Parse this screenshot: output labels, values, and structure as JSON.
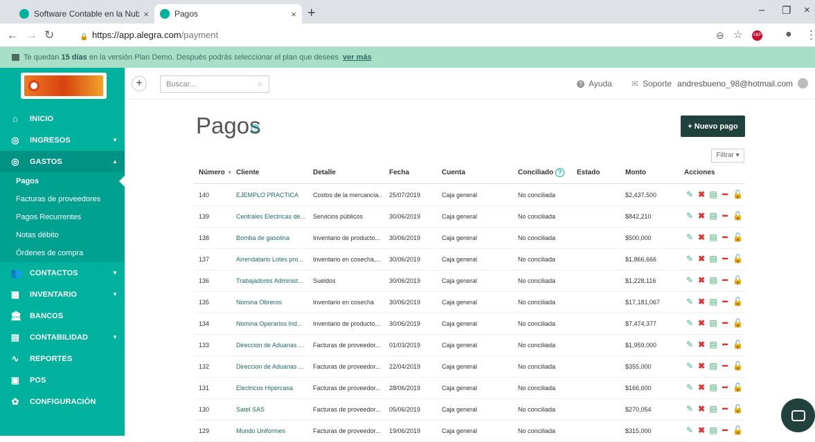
{
  "browser": {
    "tabs": [
      {
        "title": "Software Contable en la Nube pa",
        "close": "×"
      },
      {
        "title": "Pagos",
        "close": "×"
      }
    ],
    "new_tab": "+",
    "url_host": "https://app.alegra.com",
    "url_path": "/payment",
    "window_controls": {
      "minimize": "–",
      "maximize": "❐",
      "close": "×"
    }
  },
  "banner": {
    "text_before": "Te quedan",
    "days": "15 días",
    "text_after": "en la versión Plan Demo. Después podrás seleccionar el plan que desees",
    "link": "ver más"
  },
  "sidebar": {
    "items": [
      {
        "label": "INICIO",
        "icon": "home-icon",
        "glyph": "⌂"
      },
      {
        "label": "INGRESOS",
        "icon": "income-icon",
        "glyph": "◎",
        "caret": "▼"
      },
      {
        "label": "GASTOS",
        "icon": "expenses-icon",
        "glyph": "◎",
        "caret": "▲"
      },
      {
        "label": "CONTACTOS",
        "icon": "contacts-icon",
        "glyph": "👥",
        "caret": "▼"
      },
      {
        "label": "INVENTARIO",
        "icon": "inventory-icon",
        "glyph": "▦",
        "caret": "▼"
      },
      {
        "label": "BANCOS",
        "icon": "bank-icon",
        "glyph": "🏛"
      },
      {
        "label": "CONTABILIDAD",
        "icon": "accounting-icon",
        "glyph": "▤",
        "caret": "▼"
      },
      {
        "label": "REPORTES",
        "icon": "reports-icon",
        "glyph": "∿"
      },
      {
        "label": "POS",
        "icon": "pos-icon",
        "glyph": "▣"
      },
      {
        "label": "CONFIGURACIÓN",
        "icon": "settings-icon",
        "glyph": "✿"
      }
    ],
    "sub_items": [
      "Pagos",
      "Facturas de proveedores",
      "Pagos Recurrentes",
      "Notas débito",
      "Órdenes de compra"
    ]
  },
  "topbar": {
    "plus": "+",
    "search_placeholder": "Buscar...",
    "help": "Ayuda",
    "support": "Soporte",
    "user": "andresbueno_98@hotmail.com"
  },
  "page": {
    "title": "Pagos",
    "new_button": "+ Nuevo pago",
    "filter": "Filtrar ▾"
  },
  "table": {
    "headers": {
      "numero": "Número",
      "cliente": "Cliente",
      "detalle": "Detalle",
      "fecha": "Fecha",
      "cuenta": "Cuenta",
      "conciliado": "Conciliado",
      "estado": "Estado",
      "monto": "Monto",
      "acciones": "Acciones"
    },
    "rows": [
      {
        "numero": "140",
        "cliente": "EJEMPLO PRACTICA",
        "detalle": "Costos de la mercancía...",
        "fecha": "25/07/2019",
        "cuenta": "Caja general",
        "conciliado": "No conciliada",
        "monto": "$2,437,500"
      },
      {
        "numero": "139",
        "cliente": "Centrales Electricas de...",
        "detalle": "Servicios públicos",
        "fecha": "30/06/2019",
        "cuenta": "Caja general",
        "conciliado": "No conciliada",
        "monto": "$842,210"
      },
      {
        "numero": "138",
        "cliente": "Bomba de gasolina",
        "detalle": "Inventario de producto...",
        "fecha": "30/06/2019",
        "cuenta": "Caja general",
        "conciliado": "No conciliada",
        "monto": "$500,000"
      },
      {
        "numero": "137",
        "cliente": "Arrendatario Lotes pro...",
        "detalle": "Inventario en cosecha,...",
        "fecha": "30/06/2019",
        "cuenta": "Caja general",
        "conciliado": "No conciliada",
        "monto": "$1,866,666"
      },
      {
        "numero": "136",
        "cliente": "Trabajadores Administ...",
        "detalle": "Sueldos",
        "fecha": "30/06/2019",
        "cuenta": "Caja general",
        "conciliado": "No conciliada",
        "monto": "$1,228,116"
      },
      {
        "numero": "135",
        "cliente": "Nomina Obreros",
        "detalle": "Inventario en cosecha",
        "fecha": "30/06/2019",
        "cuenta": "Caja general",
        "conciliado": "No conciliada",
        "monto": "$17,181,067"
      },
      {
        "numero": "134",
        "cliente": "Nomina Operarios Ind...",
        "detalle": "Inventario de producto...",
        "fecha": "30/06/2019",
        "cuenta": "Caja general",
        "conciliado": "No conciliada",
        "monto": "$7,474,377"
      },
      {
        "numero": "133",
        "cliente": "Direccion de Aduanas ...",
        "detalle": "Facturas de proveedor...",
        "fecha": "01/03/2019",
        "cuenta": "Caja general",
        "conciliado": "No conciliada",
        "monto": "$1,959,000"
      },
      {
        "numero": "132",
        "cliente": "Direccion de Aduanas ...",
        "detalle": "Facturas de proveedor...",
        "fecha": "22/04/2019",
        "cuenta": "Caja general",
        "conciliado": "No conciliada",
        "monto": "$355,000"
      },
      {
        "numero": "131",
        "cliente": "Electricos Hipercasa",
        "detalle": "Facturas de proveedor...",
        "fecha": "28/06/2019",
        "cuenta": "Caja general",
        "conciliado": "No conciliada",
        "monto": "$166,600"
      },
      {
        "numero": "130",
        "cliente": "Satel SAS",
        "detalle": "Facturas de proveedor...",
        "fecha": "05/06/2019",
        "cuenta": "Caja general",
        "conciliado": "No conciliada",
        "monto": "$270,054"
      },
      {
        "numero": "129",
        "cliente": "Mundo Uniformes",
        "detalle": "Facturas de proveedor...",
        "fecha": "19/06/2019",
        "cuenta": "Caja general",
        "conciliado": "No conciliada",
        "monto": "$315,000"
      }
    ]
  },
  "colors": {
    "brand": "#00b19d",
    "banner": "#a8dfc9",
    "dark_button": "#20413c"
  }
}
